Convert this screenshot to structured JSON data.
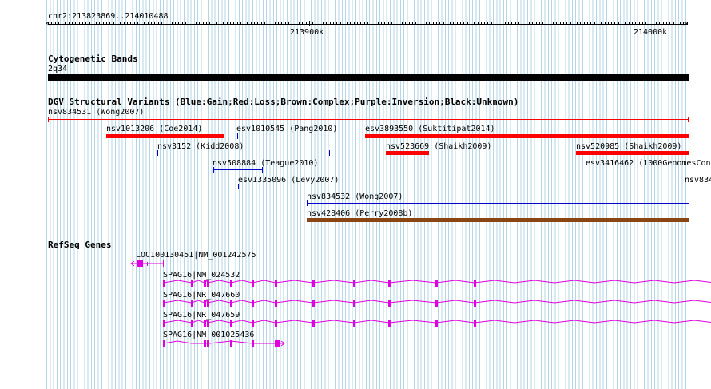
{
  "ruler": {
    "location": "chr2:213823869..214010488",
    "tick_labels": [
      "213900k",
      "214000k"
    ]
  },
  "cytoband": {
    "title": "Cytogenetic Bands",
    "band_label": "2q34",
    "color": "#000000"
  },
  "dgv": {
    "title": "DGV Structural Variants (Blue:Gain;Red:Loss;Brown:Complex;Purple:Inversion;Black:Unknown)",
    "colors": {
      "loss": "#ff0000",
      "gain": "#0000cc",
      "complex": "#8b4513"
    },
    "variants": [
      {
        "label": "nsv834531 (Wong2007)",
        "type": "loss-line"
      },
      {
        "label": "nsv1013206 (Coe2014)",
        "type": "loss"
      },
      {
        "label": "esv1010545 (Pang2010)",
        "type": "gain"
      },
      {
        "label": "esv3893550 (Suktitipat2014)",
        "type": "loss"
      },
      {
        "label": "nsv3152 (Kidd2008)",
        "type": "gain"
      },
      {
        "label": "nsv523669 (Shaikh2009)",
        "type": "loss"
      },
      {
        "label": "nsv520985 (Shaikh2009)",
        "type": "loss"
      },
      {
        "label": "nsv508884 (Teague2010)",
        "type": "gain"
      },
      {
        "label": "esv3416462 (1000GenomesCons",
        "type": "gain"
      },
      {
        "label": "esv1335096 (Levy2007)",
        "type": "gain"
      },
      {
        "label": "nsv834",
        "type": "gain"
      },
      {
        "label": "nsv834532 (Wong2007)",
        "type": "gain"
      },
      {
        "label": "nsv428406 (Perry2008b)",
        "type": "complex"
      }
    ]
  },
  "refseq": {
    "title": "RefSeq Genes",
    "color": "#e000e0",
    "genes": [
      {
        "label": "LOC100130451|NM_001242575"
      },
      {
        "label": "SPAG16|NM_024532"
      },
      {
        "label": "SPAG16|NR_047660"
      },
      {
        "label": "SPAG16|NR_047659"
      },
      {
        "label": "SPAG16|NM_001025436"
      }
    ]
  }
}
